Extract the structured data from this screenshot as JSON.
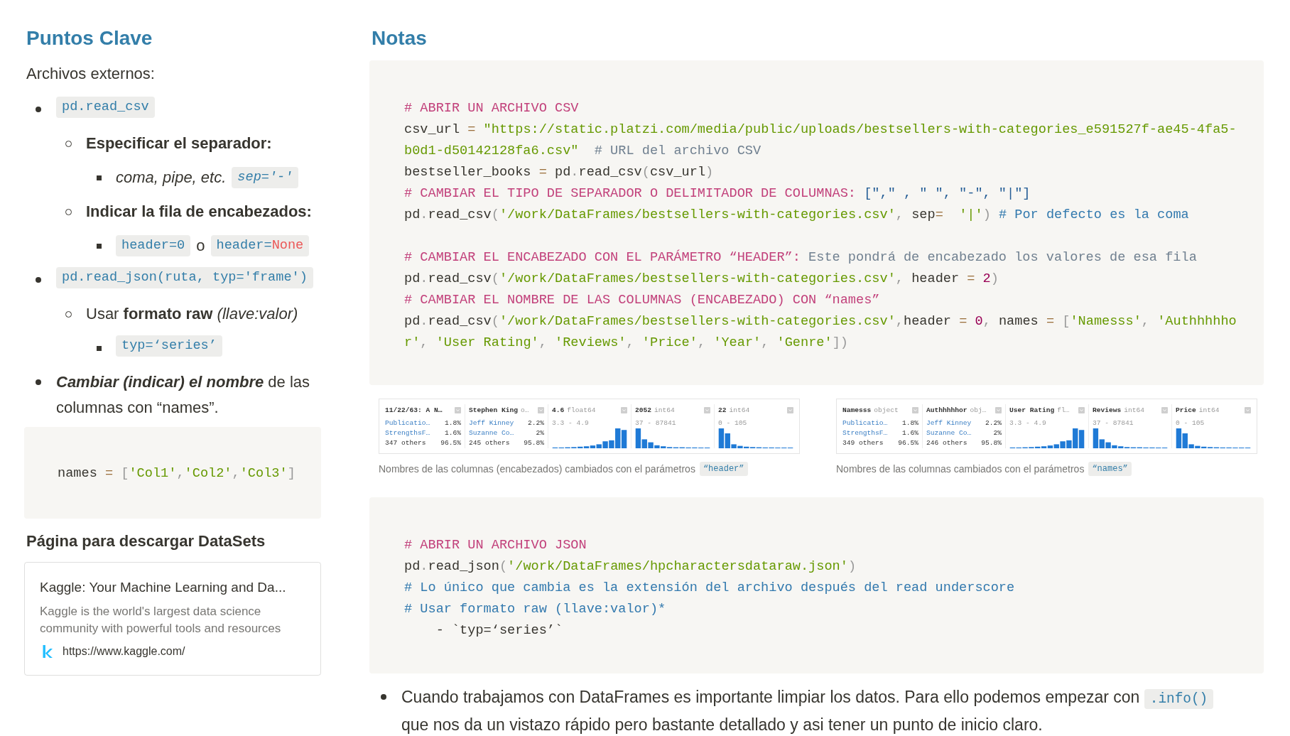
{
  "key_points": {
    "title": "Puntos Clave",
    "subtitle": "Archivos externos:",
    "items": [
      {
        "content": [
          {
            "kind": "code",
            "italic": false,
            "tokens": [
              {
                "kind": "name",
                "text": "pd.read_csv"
              }
            ]
          }
        ],
        "children": [
          {
            "content": [
              {
                "kind": "bold",
                "text": "Especificar el separador:"
              }
            ],
            "children": [
              {
                "content": [
                  {
                    "kind": "italic",
                    "text": "coma, pipe, etc."
                  },
                  {
                    "kind": "code",
                    "italic": true,
                    "tokens": [
                      {
                        "kind": "name",
                        "text": "sep='-'"
                      }
                    ]
                  }
                ]
              }
            ]
          },
          {
            "content": [
              {
                "kind": "bold",
                "text": "Indicar la fila de encabezados:"
              }
            ],
            "children": [
              {
                "content": [
                  {
                    "kind": "code",
                    "italic": false,
                    "tokens": [
                      {
                        "kind": "name",
                        "text": "header=0"
                      }
                    ]
                  },
                  {
                    "kind": "text",
                    "text": "o"
                  },
                  {
                    "kind": "code",
                    "italic": false,
                    "tokens": [
                      {
                        "kind": "name",
                        "text": "header="
                      },
                      {
                        "kind": "constant",
                        "text": "None"
                      }
                    ]
                  }
                ]
              }
            ]
          }
        ]
      },
      {
        "content": [
          {
            "kind": "code",
            "italic": false,
            "tokens": [
              {
                "kind": "name",
                "text": "pd.read_json(ruta, typ='frame')"
              }
            ]
          }
        ],
        "children": [
          {
            "content": [
              {
                "kind": "text",
                "text": "Usar **formato raw** *(llave:valor)*"
              }
            ],
            "children": [
              {
                "content": [
                  {
                    "kind": "code",
                    "italic": false,
                    "tokens": [
                      {
                        "kind": "name",
                        "text": "typ=‘series’"
                      }
                    ]
                  }
                ]
              }
            ]
          }
        ]
      },
      {
        "content": [
          {
            "kind": "bold_italic",
            "text": "Cambiar (indicar) el nombre"
          },
          {
            "kind": "text",
            "text": " de las columnas con “names”."
          }
        ]
      }
    ],
    "code_block": {
      "sections": [
        {
          "lines": [
            {
              "tokens": [
                {
                  "kind": "plain",
                  "text": "names "
                },
                {
                  "kind": "op",
                  "text": "="
                },
                {
                  "kind": "punct",
                  "text": " ["
                },
                {
                  "kind": "string",
                  "text": "'Col1'"
                },
                {
                  "kind": "punct",
                  "text": ","
                },
                {
                  "kind": "string",
                  "text": "'Col2'"
                },
                {
                  "kind": "punct",
                  "text": ","
                },
                {
                  "kind": "string",
                  "text": "'Col3'"
                },
                {
                  "kind": "punct",
                  "text": "]"
                }
              ]
            }
          ]
        }
      ]
    },
    "datasets_title": "Página para descargar DataSets",
    "bookmark": {
      "title": "Kaggle: Your Machine Learning and Da...",
      "description": "Kaggle is the world's largest data science community with powerful tools and resources",
      "url": "https://www.kaggle.com/"
    }
  },
  "notes": {
    "title": "Notas",
    "blocks": [
      {
        "kind": "code",
        "sections": [
          {
            "lines": [
              {
                "tokens": [
                  {
                    "kind": "title",
                    "text": "# ABRIR UN ARCHIVO CSV"
                  }
                ]
              },
              {
                "tokens": [
                  {
                    "kind": "plain",
                    "text": "csv_url "
                  },
                  {
                    "kind": "op",
                    "text": "="
                  },
                  {
                    "kind": "string",
                    "text": " \"https://static.platzi.com/media/public/uploads/bestsellers-with-categories_e591527f-ae45-4fa5-b0d1-d50142128fa6.csv\""
                  },
                  {
                    "kind": "comment",
                    "text": "  # URL del archivo CSV"
                  }
                ]
              },
              {
                "tokens": [
                  {
                    "kind": "plain",
                    "text": "bestseller_books "
                  },
                  {
                    "kind": "op",
                    "text": "="
                  },
                  {
                    "kind": "plain",
                    "text": " pd"
                  },
                  {
                    "kind": "punct",
                    "text": "."
                  },
                  {
                    "kind": "plain",
                    "text": "read_csv"
                  },
                  {
                    "kind": "punct",
                    "text": "("
                  },
                  {
                    "kind": "plain",
                    "text": "csv_url"
                  },
                  {
                    "kind": "punct",
                    "text": ")"
                  }
                ]
              },
              {
                "tokens": [
                  {
                    "kind": "title",
                    "text": "# CAMBIAR EL TIPO DE SEPARADOR O DELIMITADOR DE COLUMNAS:"
                  },
                  {
                    "kind": "array",
                    "text": " [\",\" , \" \", \"-\", \"|\"]"
                  }
                ]
              },
              {
                "tokens": [
                  {
                    "kind": "plain",
                    "text": "pd"
                  },
                  {
                    "kind": "punct",
                    "text": "."
                  },
                  {
                    "kind": "plain",
                    "text": "read_csv"
                  },
                  {
                    "kind": "punct",
                    "text": "("
                  },
                  {
                    "kind": "string",
                    "text": "'/work/DataFrames/bestsellers-with-categories.csv'"
                  },
                  {
                    "kind": "punct",
                    "text": ","
                  },
                  {
                    "kind": "plain",
                    "text": " sep"
                  },
                  {
                    "kind": "op",
                    "text": "="
                  },
                  {
                    "kind": "string",
                    "text": "  '|'"
                  },
                  {
                    "kind": "punct",
                    "text": ")"
                  },
                  {
                    "kind": "note",
                    "text": " # Por defecto es la coma"
                  }
                ]
              }
            ]
          },
          {
            "lines": [
              {
                "tokens": [
                  {
                    "kind": "title",
                    "text": "# CAMBIAR EL ENCABEZADO CON EL PARÁMETRO “HEADER”:"
                  },
                  {
                    "kind": "comment",
                    "text": " Este pondrá de encabezado los valores de esa fila"
                  }
                ]
              },
              {
                "tokens": [
                  {
                    "kind": "plain",
                    "text": "pd"
                  },
                  {
                    "kind": "punct",
                    "text": "."
                  },
                  {
                    "kind": "plain",
                    "text": "read_csv"
                  },
                  {
                    "kind": "punct",
                    "text": "("
                  },
                  {
                    "kind": "string",
                    "text": "'/work/DataFrames/bestsellers-with-categories.csv'"
                  },
                  {
                    "kind": "punct",
                    "text": ","
                  },
                  {
                    "kind": "plain",
                    "text": " header "
                  },
                  {
                    "kind": "op",
                    "text": "="
                  },
                  {
                    "kind": "number",
                    "text": " 2"
                  },
                  {
                    "kind": "punct",
                    "text": ")"
                  }
                ]
              },
              {
                "tokens": [
                  {
                    "kind": "title",
                    "text": "# CAMBIAR EL NOMBRE DE LAS COLUMNAS (ENCABEZADO) CON “names”"
                  }
                ]
              },
              {
                "tokens": [
                  {
                    "kind": "plain",
                    "text": "pd"
                  },
                  {
                    "kind": "punct",
                    "text": "."
                  },
                  {
                    "kind": "plain",
                    "text": "read_csv"
                  },
                  {
                    "kind": "punct",
                    "text": "("
                  },
                  {
                    "kind": "string",
                    "text": "'/work/DataFrames/bestsellers-with-categories.csv'"
                  },
                  {
                    "kind": "punct",
                    "text": ","
                  },
                  {
                    "kind": "plain",
                    "text": "header "
                  },
                  {
                    "kind": "op",
                    "text": "="
                  },
                  {
                    "kind": "number",
                    "text": " 0"
                  },
                  {
                    "kind": "punct",
                    "text": ","
                  },
                  {
                    "kind": "plain",
                    "text": " names "
                  },
                  {
                    "kind": "op",
                    "text": "="
                  },
                  {
                    "kind": "punct",
                    "text": " ["
                  },
                  {
                    "kind": "string",
                    "text": "'Namesss'"
                  },
                  {
                    "kind": "punct",
                    "text": ", "
                  },
                  {
                    "kind": "string",
                    "text": "'Authhhhhor'"
                  },
                  {
                    "kind": "punct",
                    "text": ", "
                  },
                  {
                    "kind": "string",
                    "text": "'User Rating'"
                  },
                  {
                    "kind": "punct",
                    "text": ", "
                  },
                  {
                    "kind": "string",
                    "text": "'Reviews'"
                  },
                  {
                    "kind": "punct",
                    "text": ", "
                  },
                  {
                    "kind": "string",
                    "text": "'Price'"
                  },
                  {
                    "kind": "punct",
                    "text": ", "
                  },
                  {
                    "kind": "string",
                    "text": "'Year'"
                  },
                  {
                    "kind": "punct",
                    "text": ", "
                  },
                  {
                    "kind": "string",
                    "text": "'Genre'"
                  },
                  {
                    "kind": "punct",
                    "text": "])"
                  }
                ]
              }
            ]
          }
        ]
      },
      {
        "kind": "images",
        "images": [
          {
            "columns": [
              {
                "kind": "category",
                "title": "11/22/63: A N…",
                "rows": [
                  {
                    "kind": "top",
                    "label": "Publicatio…",
                    "share": "1.8%"
                  },
                  {
                    "kind": "top",
                    "label": "StrengthsF…",
                    "share": "1.6%"
                  },
                  {
                    "kind": "others",
                    "label": "347 others",
                    "share": "96.5%"
                  }
                ]
              },
              {
                "kind": "category",
                "title": "Stephen King",
                "type": "o…",
                "rows": [
                  {
                    "kind": "top",
                    "label": "Jeff Kinney",
                    "share": "2.2%"
                  },
                  {
                    "kind": "top",
                    "label": "Suzanne Co…",
                    "share": "2%"
                  },
                  {
                    "kind": "others",
                    "label": "245 others",
                    "share": "95.8%"
                  }
                ]
              },
              {
                "kind": "numeric",
                "title": "4.6",
                "type": "float64",
                "range": "3.3 - 4.9"
              },
              {
                "kind": "numeric",
                "title": "2052",
                "type": "int64",
                "range": "37 - 87841"
              },
              {
                "kind": "numeric",
                "title": "22",
                "type": "int64",
                "range": "0 - 105"
              }
            ],
            "caption": "Nombres de las columnas (encabezados) cambiados con el parámetros",
            "caption_code": "“header”"
          },
          {
            "columns": [
              {
                "kind": "category",
                "title": "Namesss",
                "type": "object",
                "rows": [
                  {
                    "kind": "top",
                    "label": "Publicatio…",
                    "share": "1.8%"
                  },
                  {
                    "kind": "top",
                    "label": "StrengthsF…",
                    "share": "1.6%"
                  },
                  {
                    "kind": "others",
                    "label": "349 others",
                    "share": "96.5%"
                  }
                ]
              },
              {
                "kind": "category",
                "title": "Authhhhhor",
                "type": "obj…",
                "rows": [
                  {
                    "kind": "top",
                    "label": "Jeff Kinney",
                    "share": "2.2%"
                  },
                  {
                    "kind": "top",
                    "label": "Suzanne Co…",
                    "share": "2%"
                  },
                  {
                    "kind": "others",
                    "label": "246 others",
                    "share": "95.8%"
                  }
                ]
              },
              {
                "kind": "numeric",
                "title": "User Rating",
                "type": "fl…",
                "range": "3.3 - 4.9"
              },
              {
                "kind": "numeric",
                "title": "Reviews",
                "type": "int64",
                "range": "37 - 87841"
              },
              {
                "kind": "numeric",
                "title": "Price",
                "type": "int64",
                "range": "0 - 105"
              }
            ],
            "caption": "Nombres de las columnas cambiados con el parámetros",
            "caption_code": "“names”"
          }
        ]
      },
      {
        "kind": "code",
        "sections": [
          {
            "lines": [
              {
                "tokens": [
                  {
                    "kind": "title",
                    "text": "# ABRIR UN ARCHIVO JSON"
                  }
                ]
              },
              {
                "tokens": [
                  {
                    "kind": "plain",
                    "text": "pd"
                  },
                  {
                    "kind": "punct",
                    "text": "."
                  },
                  {
                    "kind": "plain",
                    "text": "read_json"
                  },
                  {
                    "kind": "punct",
                    "text": "("
                  },
                  {
                    "kind": "string",
                    "text": "'/work/DataFrames/hpcharactersdataraw.json'"
                  },
                  {
                    "kind": "punct",
                    "text": ")"
                  }
                ]
              },
              {
                "tokens": [
                  {
                    "kind": "note",
                    "text": "# Lo único que cambia es la extensión del archivo después del read underscore"
                  }
                ]
              },
              {
                "tokens": [
                  {
                    "kind": "note",
                    "text": "# Usar formato raw (llave:valor)*"
                  }
                ]
              },
              {
                "tokens": [
                  {
                    "kind": "plain",
                    "text": "    - `typ=‘series’`"
                  }
                ]
              }
            ]
          }
        ]
      },
      {
        "kind": "bullet",
        "segments": [
          {
            "kind": "text",
            "text": "Cuando trabajamos con DataFrames es importante limpiar los datos. Para ello podemos empezar con "
          },
          {
            "kind": "code",
            "text": ".info()"
          },
          {
            "kind": "text",
            "text": " que nos da un vistazo rápido pero bastante detallado y asi tener un punto de inicio claro."
          }
        ]
      }
    ]
  }
}
